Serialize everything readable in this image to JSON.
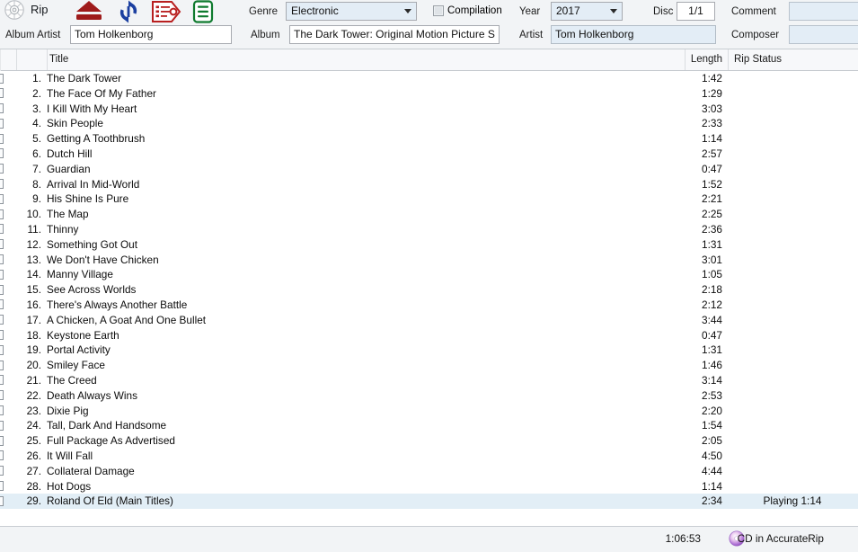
{
  "toolbar": {
    "rip_label": "Rip",
    "icons": [
      {
        "name": "cd-disc-icon",
        "title": "Rip"
      },
      {
        "name": "eject-icon",
        "title": "Eject"
      },
      {
        "name": "refresh-icon",
        "title": "Refresh"
      },
      {
        "name": "tag-list-icon",
        "title": "Metadata"
      },
      {
        "name": "document-icon",
        "title": "Log"
      }
    ]
  },
  "metadata": {
    "genre_label": "Genre",
    "genre_value": "Electronic",
    "compilation_label": "Compilation",
    "compilation_checked": false,
    "year_label": "Year",
    "year_value": "2017",
    "disc_label": "Disc",
    "disc_value": "1/1",
    "comment_label": "Comment",
    "comment_value": "",
    "album_artist_label": "Album Artist",
    "album_artist_value": "Tom Holkenborg",
    "album_label": "Album",
    "album_value": "The Dark Tower: Original Motion Picture S",
    "artist_label": "Artist",
    "artist_value": "Tom Holkenborg",
    "composer_label": "Composer",
    "composer_value": ""
  },
  "table": {
    "columns": {
      "title": "Title",
      "length": "Length",
      "rip_status": "Rip Status"
    },
    "rows": [
      {
        "num": "1.",
        "title": "The Dark Tower",
        "length": "1:42",
        "rip_status": "",
        "selected": false
      },
      {
        "num": "2.",
        "title": "The Face Of My Father",
        "length": "1:29",
        "rip_status": "",
        "selected": false
      },
      {
        "num": "3.",
        "title": "I Kill With My Heart",
        "length": "3:03",
        "rip_status": "",
        "selected": false
      },
      {
        "num": "4.",
        "title": "Skin People",
        "length": "2:33",
        "rip_status": "",
        "selected": false
      },
      {
        "num": "5.",
        "title": "Getting A Toothbrush",
        "length": "1:14",
        "rip_status": "",
        "selected": false
      },
      {
        "num": "6.",
        "title": "Dutch Hill",
        "length": "2:57",
        "rip_status": "",
        "selected": false
      },
      {
        "num": "7.",
        "title": "Guardian",
        "length": "0:47",
        "rip_status": "",
        "selected": false
      },
      {
        "num": "8.",
        "title": "Arrival In Mid-World",
        "length": "1:52",
        "rip_status": "",
        "selected": false
      },
      {
        "num": "9.",
        "title": "His Shine Is Pure",
        "length": "2:21",
        "rip_status": "",
        "selected": false
      },
      {
        "num": "10.",
        "title": "The Map",
        "length": "2:25",
        "rip_status": "",
        "selected": false
      },
      {
        "num": "11.",
        "title": "Thinny",
        "length": "2:36",
        "rip_status": "",
        "selected": false
      },
      {
        "num": "12.",
        "title": "Something Got Out",
        "length": "1:31",
        "rip_status": "",
        "selected": false
      },
      {
        "num": "13.",
        "title": "We Don't Have Chicken",
        "length": "3:01",
        "rip_status": "",
        "selected": false
      },
      {
        "num": "14.",
        "title": "Manny Village",
        "length": "1:05",
        "rip_status": "",
        "selected": false
      },
      {
        "num": "15.",
        "title": "See Across Worlds",
        "length": "2:18",
        "rip_status": "",
        "selected": false
      },
      {
        "num": "16.",
        "title": "There's Always Another Battle",
        "length": "2:12",
        "rip_status": "",
        "selected": false
      },
      {
        "num": "17.",
        "title": "A Chicken, A Goat And One Bullet",
        "length": "3:44",
        "rip_status": "",
        "selected": false
      },
      {
        "num": "18.",
        "title": "Keystone Earth",
        "length": "0:47",
        "rip_status": "",
        "selected": false
      },
      {
        "num": "19.",
        "title": "Portal Activity",
        "length": "1:31",
        "rip_status": "",
        "selected": false
      },
      {
        "num": "20.",
        "title": "Smiley Face",
        "length": "1:46",
        "rip_status": "",
        "selected": false
      },
      {
        "num": "21.",
        "title": "The Creed",
        "length": "3:14",
        "rip_status": "",
        "selected": false
      },
      {
        "num": "22.",
        "title": "Death Always Wins",
        "length": "2:53",
        "rip_status": "",
        "selected": false
      },
      {
        "num": "23.",
        "title": "Dixie Pig",
        "length": "2:20",
        "rip_status": "",
        "selected": false
      },
      {
        "num": "24.",
        "title": "Tall, Dark And Handsome",
        "length": "1:54",
        "rip_status": "",
        "selected": false
      },
      {
        "num": "25.",
        "title": "Full Package As Advertised",
        "length": "2:05",
        "rip_status": "",
        "selected": false
      },
      {
        "num": "26.",
        "title": "It Will Fall",
        "length": "4:50",
        "rip_status": "",
        "selected": false
      },
      {
        "num": "27.",
        "title": "Collateral Damage",
        "length": "4:44",
        "rip_status": "",
        "selected": false
      },
      {
        "num": "28.",
        "title": "Hot Dogs",
        "length": "1:14",
        "rip_status": "",
        "selected": false
      },
      {
        "num": "29.",
        "title": "Roland Of Eld (Main Titles)",
        "length": "2:34",
        "rip_status": "Playing 1:14",
        "selected": true
      }
    ]
  },
  "status": {
    "total_time": "1:06:53",
    "accuraterip_text": "CD in AccurateRip",
    "cd_icon": "cd-disc-icon"
  },
  "colors": {
    "field_blue": "#e3edf6",
    "selection": "#e2eef6",
    "panel": "#f2f4f6",
    "icon_red": "#9e1b1b",
    "icon_blue": "#1b3fa0",
    "icon_green": "#0f7a2e"
  }
}
